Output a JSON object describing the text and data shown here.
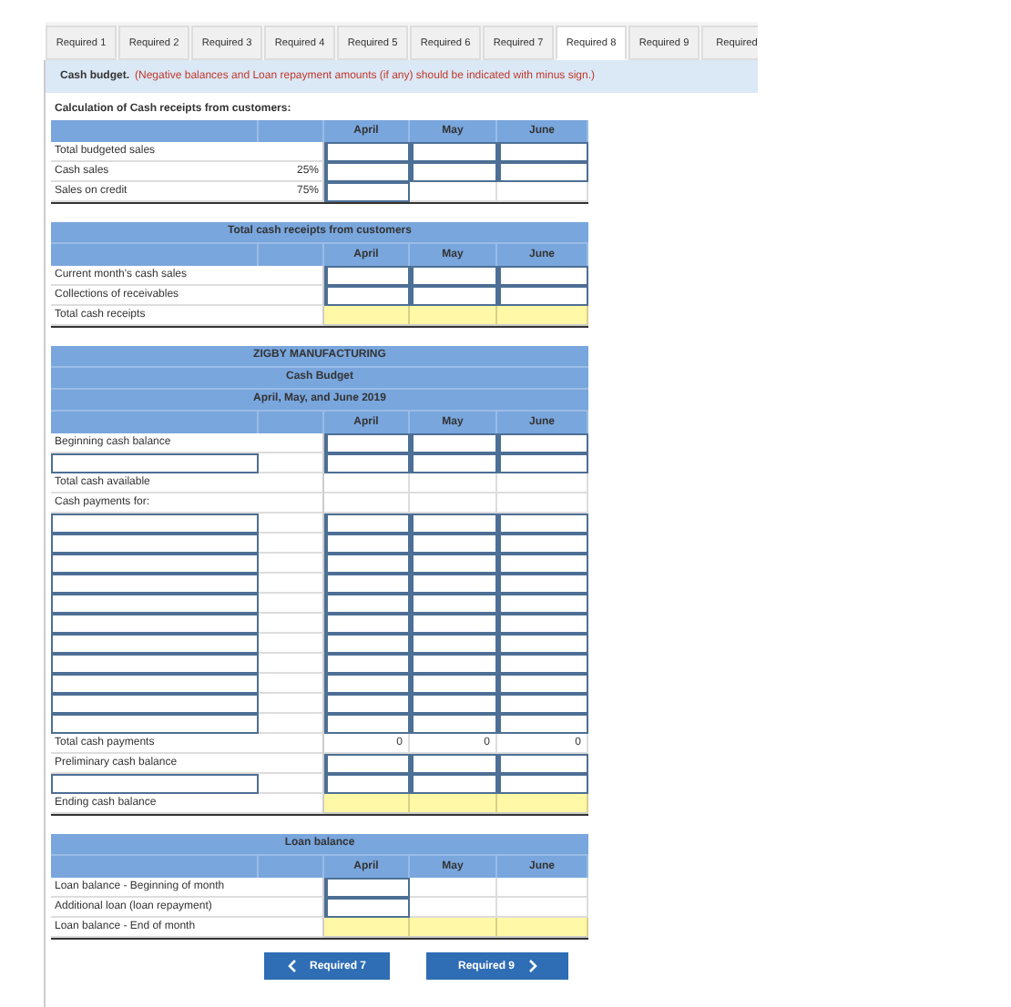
{
  "tabs": [
    {
      "label": "Required 1",
      "selected": false
    },
    {
      "label": "Required 2",
      "selected": false
    },
    {
      "label": "Required 3",
      "selected": false
    },
    {
      "label": "Required 4",
      "selected": false
    },
    {
      "label": "Required 5",
      "selected": false
    },
    {
      "label": "Required 6",
      "selected": false
    },
    {
      "label": "Required 7",
      "selected": false
    },
    {
      "label": "Required 8",
      "selected": true
    },
    {
      "label": "Required 9",
      "selected": false
    },
    {
      "label": "Required",
      "selected": false
    }
  ],
  "instruction": {
    "label": "Cash budget.",
    "note": "(Negative balances and Loan repayment amounts (if any) should be indicated with minus sign.)"
  },
  "sections": [
    {
      "heading": "Calculation of Cash receipts from customers:",
      "columns": [
        "April",
        "May",
        "June"
      ],
      "rows": [
        {
          "kind": "labeled",
          "label": "Total budgeted sales",
          "cells": [
            {
              "kind": "input"
            },
            {
              "kind": "input"
            },
            {
              "kind": "input"
            }
          ]
        },
        {
          "kind": "labeled",
          "label": "Cash sales",
          "percent": "25%",
          "cells": [
            {
              "kind": "input"
            },
            {
              "kind": "input"
            },
            {
              "kind": "input"
            }
          ]
        },
        {
          "kind": "labeled",
          "label": "Sales on credit",
          "percent": "75%",
          "cells": [
            {
              "kind": "input"
            },
            {
              "kind": "blank"
            },
            {
              "kind": "blank"
            }
          ]
        }
      ]
    },
    {
      "titles": [
        "Total cash receipts from customers"
      ],
      "columns": [
        "April",
        "May",
        "June"
      ],
      "rows": [
        {
          "kind": "labeled",
          "label": "Current month's cash sales",
          "cells": [
            {
              "kind": "input"
            },
            {
              "kind": "input"
            },
            {
              "kind": "input"
            }
          ]
        },
        {
          "kind": "labeled",
          "label": "Collections of receivables",
          "cells": [
            {
              "kind": "input"
            },
            {
              "kind": "input"
            },
            {
              "kind": "input"
            }
          ]
        },
        {
          "kind": "labeled",
          "label": "Total cash receipts",
          "cells": [
            {
              "kind": "total"
            },
            {
              "kind": "total"
            },
            {
              "kind": "total"
            }
          ]
        }
      ]
    },
    {
      "titles": [
        "ZIGBY MANUFACTURING",
        "Cash Budget",
        "April, May, and June 2019"
      ],
      "columns": [
        "April",
        "May",
        "June"
      ],
      "rows": [
        {
          "kind": "labeled",
          "label": "Beginning cash balance",
          "cells": [
            {
              "kind": "input"
            },
            {
              "kind": "input"
            },
            {
              "kind": "input"
            }
          ]
        },
        {
          "kind": "entry",
          "cells": [
            {
              "kind": "input"
            },
            {
              "kind": "input"
            },
            {
              "kind": "input"
            }
          ]
        },
        {
          "kind": "labeled",
          "label": "Total cash available",
          "cells": [
            {
              "kind": "blank"
            },
            {
              "kind": "blank"
            },
            {
              "kind": "blank"
            }
          ]
        },
        {
          "kind": "labeled",
          "label": "Cash payments for:",
          "cells": [
            {
              "kind": "blank"
            },
            {
              "kind": "blank"
            },
            {
              "kind": "blank"
            }
          ]
        },
        {
          "kind": "entry",
          "cells": [
            {
              "kind": "input"
            },
            {
              "kind": "input"
            },
            {
              "kind": "input"
            }
          ]
        },
        {
          "kind": "entry",
          "cells": [
            {
              "kind": "input"
            },
            {
              "kind": "input"
            },
            {
              "kind": "input"
            }
          ]
        },
        {
          "kind": "entry",
          "cells": [
            {
              "kind": "input"
            },
            {
              "kind": "input"
            },
            {
              "kind": "input"
            }
          ]
        },
        {
          "kind": "entry",
          "cells": [
            {
              "kind": "input"
            },
            {
              "kind": "input"
            },
            {
              "kind": "input"
            }
          ]
        },
        {
          "kind": "entry",
          "cells": [
            {
              "kind": "input"
            },
            {
              "kind": "input"
            },
            {
              "kind": "input"
            }
          ]
        },
        {
          "kind": "entry",
          "cells": [
            {
              "kind": "input"
            },
            {
              "kind": "input"
            },
            {
              "kind": "input"
            }
          ]
        },
        {
          "kind": "entry",
          "cells": [
            {
              "kind": "input"
            },
            {
              "kind": "input"
            },
            {
              "kind": "input"
            }
          ]
        },
        {
          "kind": "entry",
          "cells": [
            {
              "kind": "input"
            },
            {
              "kind": "input"
            },
            {
              "kind": "input"
            }
          ]
        },
        {
          "kind": "entry",
          "cells": [
            {
              "kind": "input"
            },
            {
              "kind": "input"
            },
            {
              "kind": "input"
            }
          ]
        },
        {
          "kind": "entry",
          "cells": [
            {
              "kind": "input"
            },
            {
              "kind": "input"
            },
            {
              "kind": "input"
            }
          ]
        },
        {
          "kind": "entry",
          "cells": [
            {
              "kind": "input"
            },
            {
              "kind": "input"
            },
            {
              "kind": "input"
            }
          ]
        },
        {
          "kind": "labeled",
          "label": "Total cash payments",
          "cells": [
            {
              "kind": "value",
              "text": "0"
            },
            {
              "kind": "value",
              "text": "0"
            },
            {
              "kind": "value",
              "text": "0"
            }
          ]
        },
        {
          "kind": "labeled",
          "label": "Preliminary cash balance",
          "cells": [
            {
              "kind": "input"
            },
            {
              "kind": "input"
            },
            {
              "kind": "input"
            }
          ]
        },
        {
          "kind": "entry",
          "cells": [
            {
              "kind": "input"
            },
            {
              "kind": "input"
            },
            {
              "kind": "input"
            }
          ]
        },
        {
          "kind": "labeled",
          "label": "Ending cash balance",
          "cells": [
            {
              "kind": "total"
            },
            {
              "kind": "total"
            },
            {
              "kind": "total"
            }
          ]
        }
      ]
    },
    {
      "titles": [
        "Loan balance"
      ],
      "columns": [
        "April",
        "May",
        "June"
      ],
      "rows": [
        {
          "kind": "labeled",
          "label": "Loan balance - Beginning of month",
          "cells": [
            {
              "kind": "input"
            },
            {
              "kind": "blank"
            },
            {
              "kind": "blank"
            }
          ]
        },
        {
          "kind": "labeled",
          "label": "Additional loan (loan repayment)",
          "cells": [
            {
              "kind": "input"
            },
            {
              "kind": "blank"
            },
            {
              "kind": "blank"
            }
          ]
        },
        {
          "kind": "labeled",
          "label": "Loan balance - End of month",
          "cells": [
            {
              "kind": "total"
            },
            {
              "kind": "total"
            },
            {
              "kind": "total"
            }
          ]
        }
      ]
    }
  ],
  "nav": [
    {
      "label": "Required 7",
      "kind": "prev"
    },
    {
      "label": "Required 9",
      "kind": "next"
    }
  ]
}
